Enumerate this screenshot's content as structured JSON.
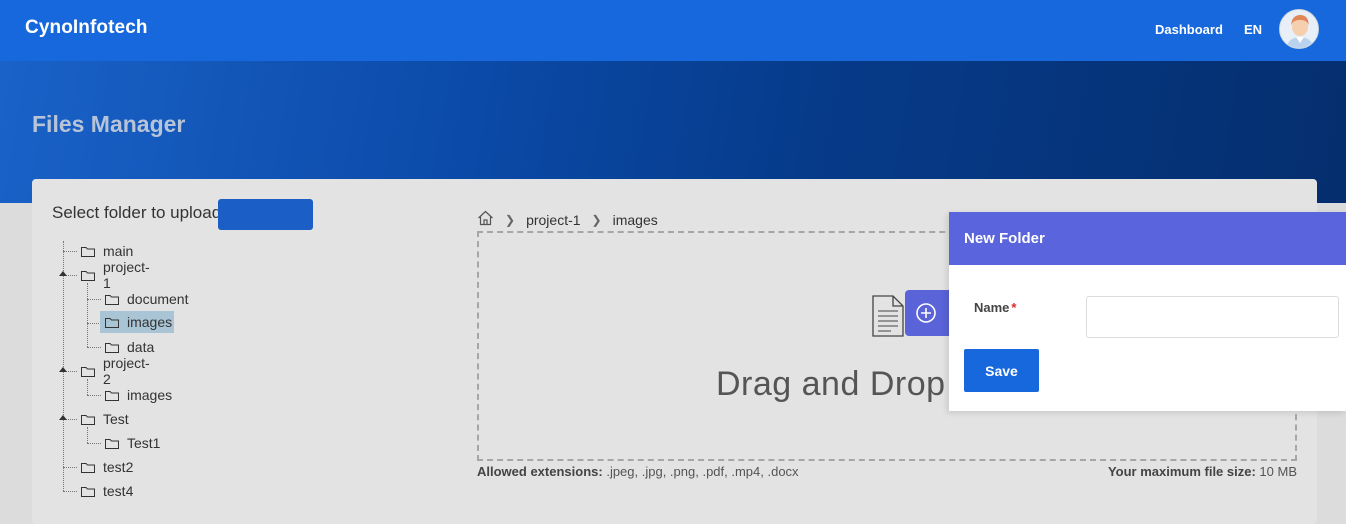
{
  "header": {
    "brand": "CynoInfotech",
    "nav": {
      "dashboard": "Dashboard",
      "language": "EN"
    },
    "avatar_icon": "user-avatar-icon"
  },
  "hero": {
    "title": "Files Manager"
  },
  "uploader": {
    "select_label": "Select folder to upload",
    "tree": [
      {
        "label": "main"
      },
      {
        "label": "project-1"
      },
      {
        "label": "document"
      },
      {
        "label": "images"
      },
      {
        "label": "data"
      },
      {
        "label": "project-2"
      },
      {
        "label": "images"
      },
      {
        "label": "Test"
      },
      {
        "label": "Test1"
      },
      {
        "label": "test2"
      },
      {
        "label": "test4"
      }
    ],
    "selected_folder": "images",
    "breadcrumb": [
      "project-1",
      "images"
    ],
    "dropzone_text": "Drag and Drop fi",
    "allowed_label": "Allowed extensions:",
    "allowed_value": ".jpeg, .jpg, .png, .pdf, .mp4, .docx",
    "max_size_label": "Your maximum file size:",
    "max_size_value": "10 MB"
  },
  "modal": {
    "title": "New Folder",
    "name_label": "Name",
    "required_mark": "*",
    "name_value": "",
    "save_label": "Save"
  },
  "colors": {
    "topbar": "#1668dc",
    "modal_header": "#5a64dc",
    "accent": "#1668dc"
  }
}
